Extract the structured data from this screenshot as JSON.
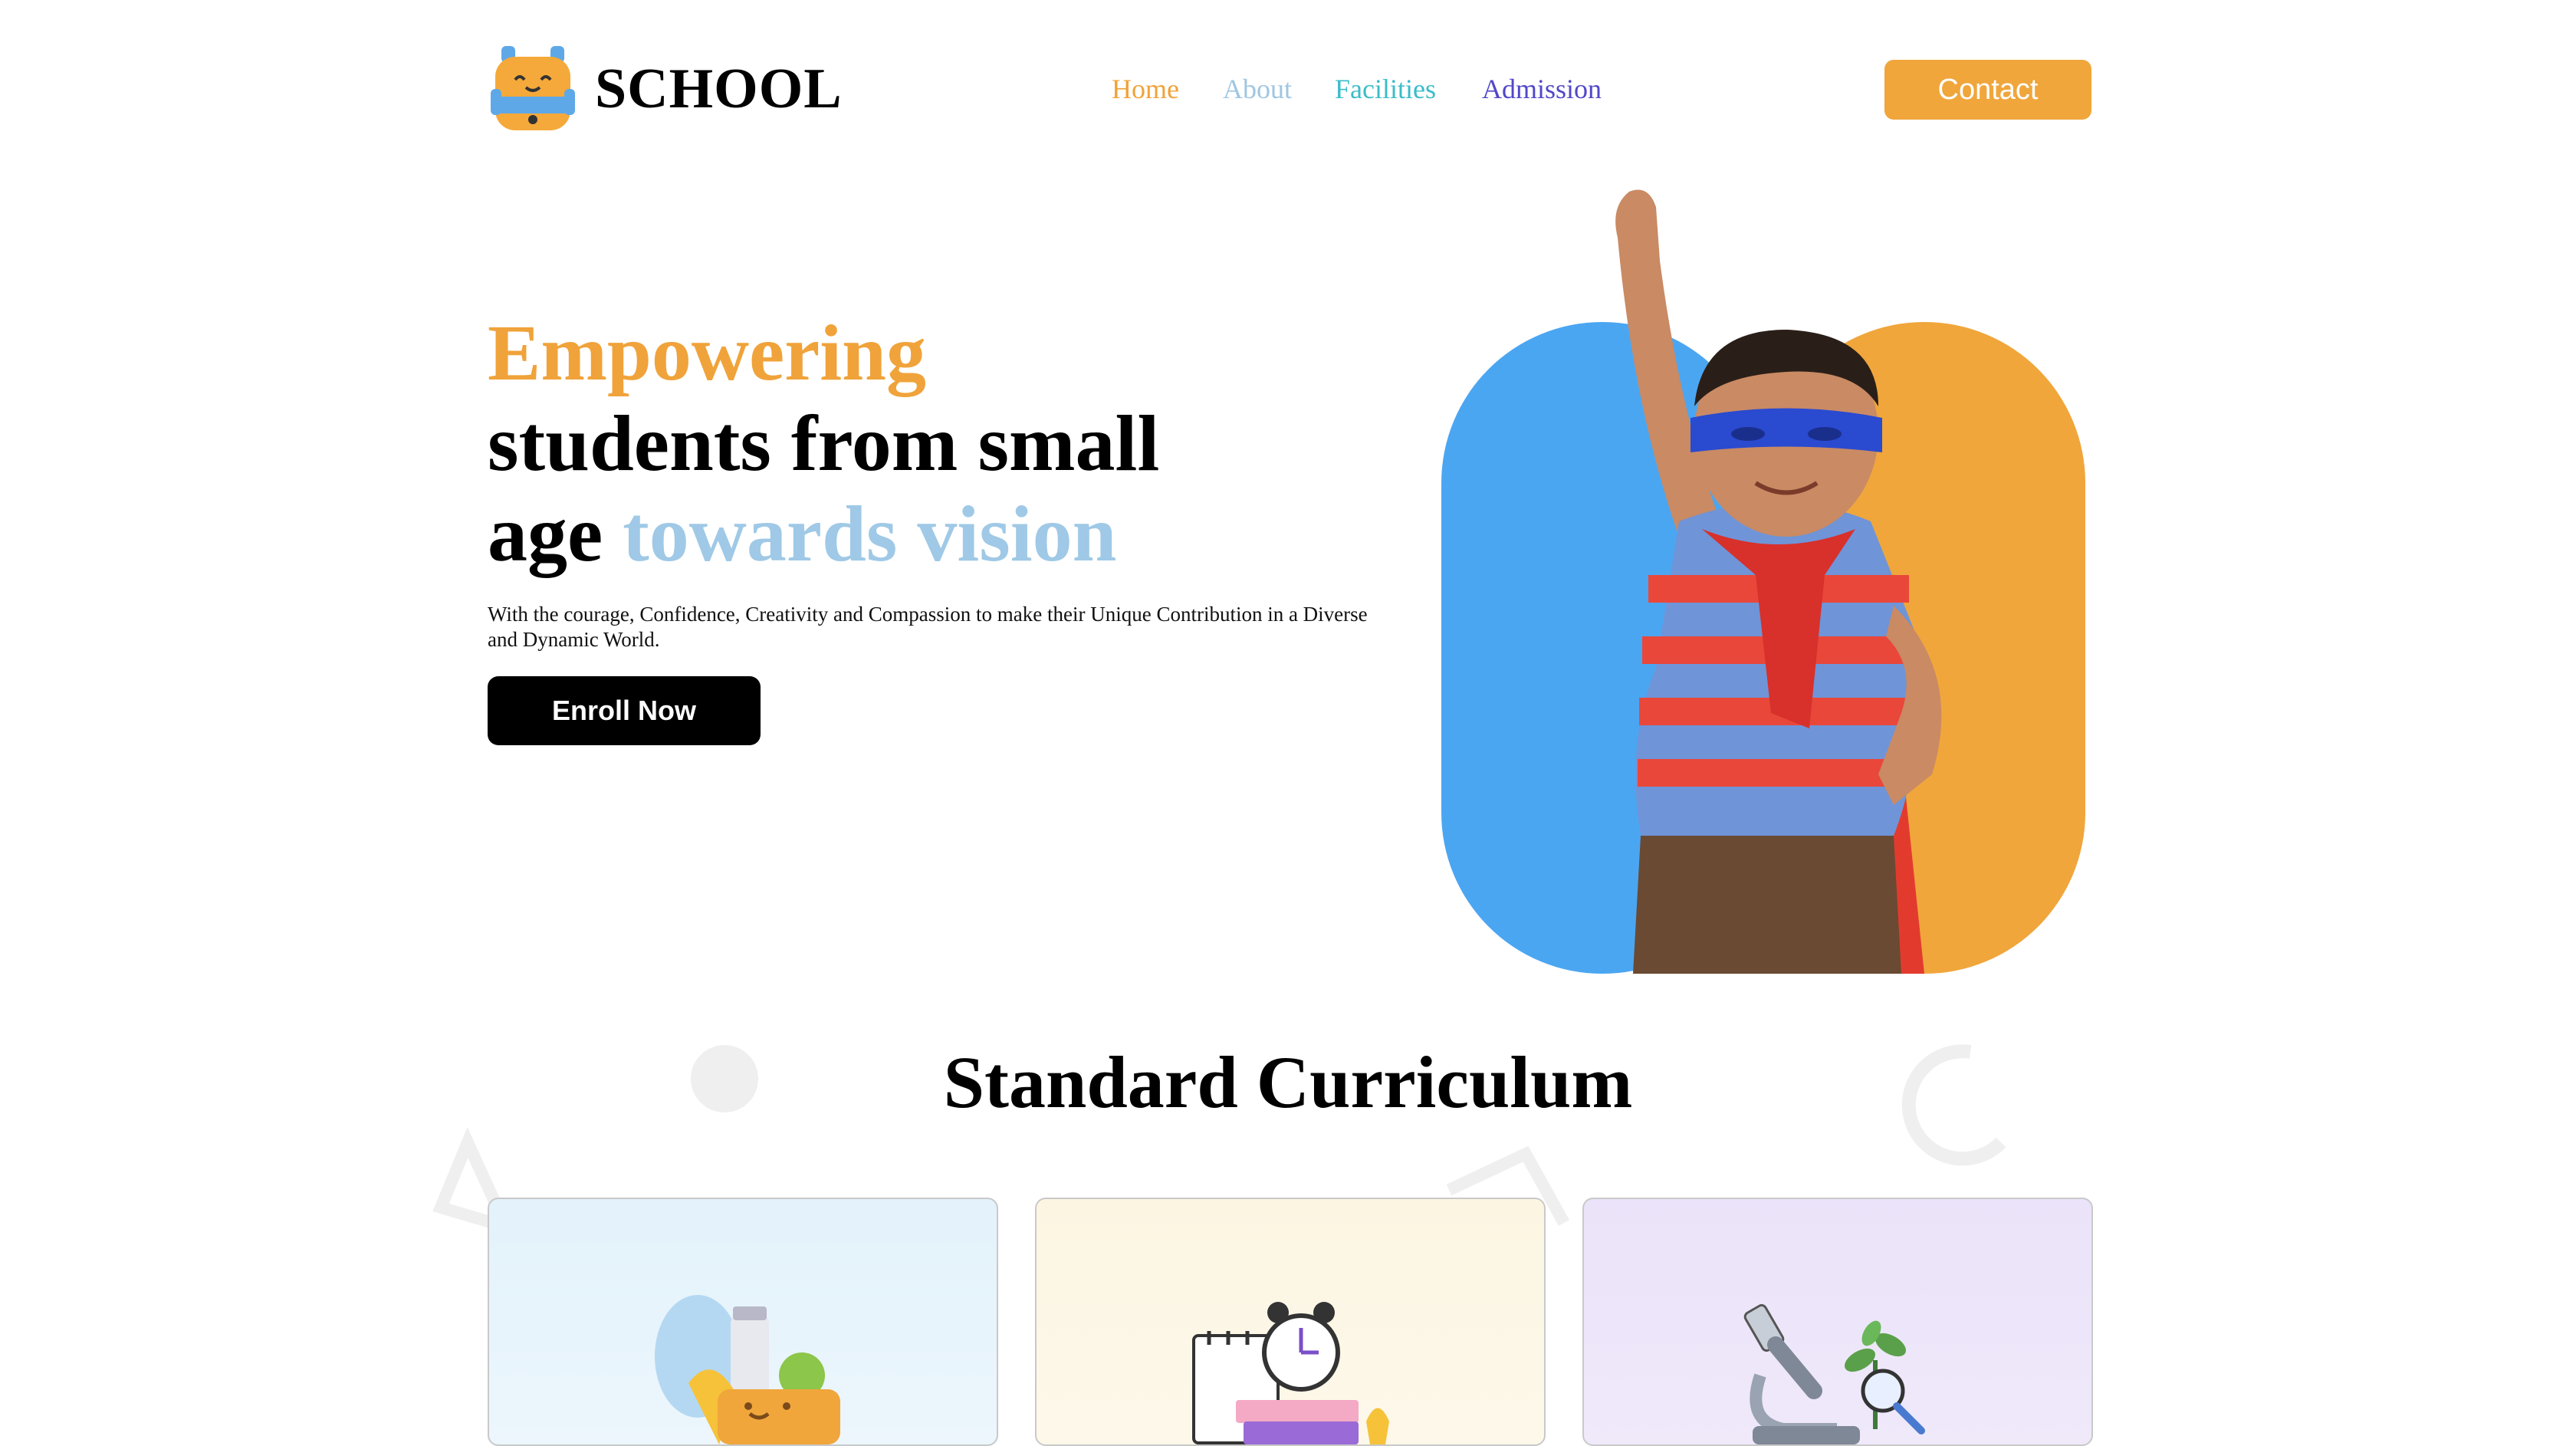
{
  "brand": {
    "name": "SCHOOL",
    "logo_icon": "school-backpack-icon"
  },
  "nav": {
    "items": [
      {
        "label": "Home",
        "color": "#f0a33a"
      },
      {
        "label": "About",
        "color": "#9fc6e2"
      },
      {
        "label": "Facilities",
        "color": "#3bbcc9"
      },
      {
        "label": "Admission",
        "color": "#5147c9"
      }
    ],
    "contact_label": "Contact"
  },
  "hero": {
    "title_part1": "Empowering",
    "title_part2": "students from small",
    "title_part3": "age ",
    "title_part4": "towards vision",
    "description": "With the courage, Confidence, Creativity and Compassion to make their Unique Contribution in a Diverse and Dynamic World.",
    "enroll_label": "Enroll Now",
    "image": "superhero-kid-photo"
  },
  "curriculum": {
    "title": "Standard Curriculum",
    "cards": [
      {
        "illustration": "lunchbox-food-icon"
      },
      {
        "illustration": "alarm-clock-books-icon"
      },
      {
        "illustration": "microscope-plant-icon"
      }
    ]
  },
  "colors": {
    "accent_orange": "#f0a63b",
    "accent_blue": "#4ba6f2",
    "dark": "#000000"
  }
}
